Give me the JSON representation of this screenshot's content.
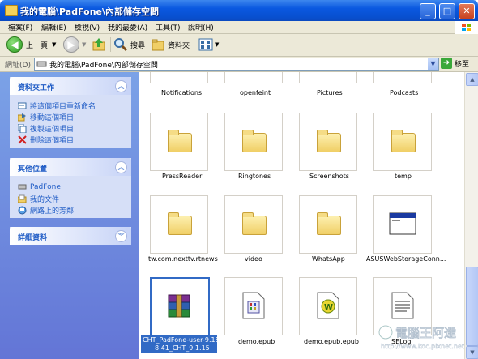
{
  "window": {
    "title": "我的電腦\\PadFone\\內部儲存空間"
  },
  "menu": [
    "檔案(F)",
    "編輯(E)",
    "檢視(V)",
    "我的最愛(A)",
    "工具(T)",
    "說明(H)"
  ],
  "toolbar": {
    "back_label": "上一頁",
    "search_label": "搜尋",
    "folders_label": "資料夾"
  },
  "address": {
    "label": "網址(D)",
    "value": "我的電腦\\PadFone\\內部儲存空間",
    "go_label": "移至"
  },
  "panels": {
    "folder_tasks": {
      "title": "資料夾工作",
      "items": [
        "將這個項目重新命名",
        "移動這個項目",
        "複製這個項目",
        "刪除這個項目"
      ]
    },
    "other_places": {
      "title": "其他位置",
      "items": [
        "PadFone",
        "我的文件",
        "網路上的芳鄰"
      ]
    },
    "details": {
      "title": "詳細資料"
    }
  },
  "files": {
    "row0": [
      "Notifications",
      "openfeint",
      "Pictures",
      "Podcasts"
    ],
    "row1": [
      "PressReader",
      "Ringtones",
      "Screenshots",
      "temp"
    ],
    "row2": [
      "tw.com.nexttv.rtnews",
      "video",
      "WhatsApp",
      "ASUSWebStorageConn..."
    ],
    "row3_selected_line1": "CHT_PadFone-user-9.18.",
    "row3_selected_line2": "8.41_CHT_9.1.15",
    "row3": [
      "demo.epub",
      "demo.epub.epub",
      "SELog"
    ]
  },
  "watermark": {
    "text": "電腦王阿達",
    "url": "http://www.koc.pixnet.net"
  },
  "colors": {
    "titlebar": "#0a58e0",
    "sidebar": "#7ba2e7",
    "link": "#215dc6",
    "selection": "#316ac5"
  }
}
